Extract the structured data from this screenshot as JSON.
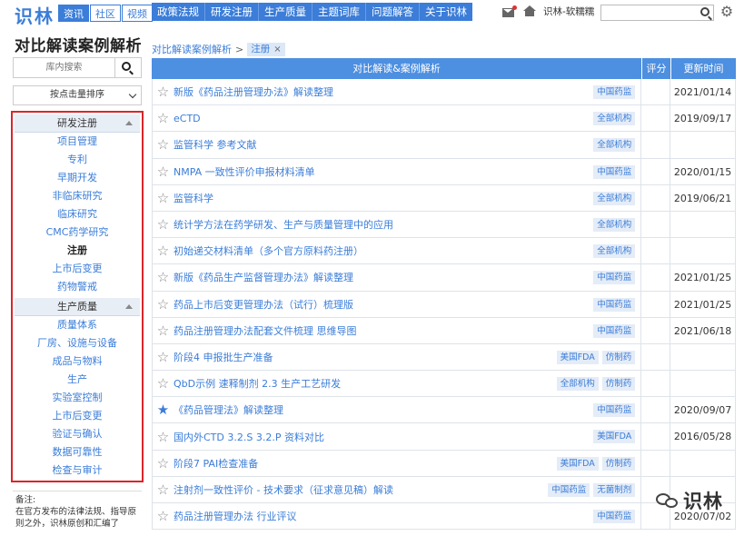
{
  "header": {
    "logo": "识林",
    "site_tabs": [
      {
        "label": "资讯",
        "active": true
      },
      {
        "label": "社区",
        "active": false
      },
      {
        "label": "视频",
        "active": false
      }
    ],
    "nav": [
      "政策法规",
      "研发注册",
      "生产质量",
      "主题词库",
      "问题解答",
      "关于识林"
    ],
    "user_name": "识林-软糯糯",
    "search_value": ""
  },
  "sidebar": {
    "title": "对比解读案例解析",
    "search_placeholder": "库内搜索",
    "sort_label": "按点击量排序",
    "groups": [
      {
        "header": "研发注册",
        "items": [
          {
            "label": "项目管理",
            "active": false
          },
          {
            "label": "专利",
            "active": false
          },
          {
            "label": "早期开发",
            "active": false
          },
          {
            "label": "非临床研究",
            "active": false
          },
          {
            "label": "临床研究",
            "active": false
          },
          {
            "label": "CMC药学研究",
            "active": false
          },
          {
            "label": "注册",
            "active": true
          },
          {
            "label": "上市后变更",
            "active": false
          },
          {
            "label": "药物警戒",
            "active": false
          }
        ]
      },
      {
        "header": "生产质量",
        "items": [
          {
            "label": "质量体系",
            "active": false
          },
          {
            "label": "厂房、设施与设备",
            "active": false
          },
          {
            "label": "成品与物料",
            "active": false
          },
          {
            "label": "生产",
            "active": false
          },
          {
            "label": "实验室控制",
            "active": false
          },
          {
            "label": "上市后变更",
            "active": false
          },
          {
            "label": "验证与确认",
            "active": false
          },
          {
            "label": "数据可靠性",
            "active": false
          },
          {
            "label": "检查与审计",
            "active": false
          }
        ]
      }
    ],
    "note_title": "备注:",
    "note_text": "在官方发布的法律法规、指导原则之外，识林原创和汇编了"
  },
  "breadcrumb": {
    "root": "对比解读案例解析",
    "separator": ">",
    "tag": "注册",
    "close": "×"
  },
  "table": {
    "headers": {
      "title": "对比解读&案例解析",
      "score": "评分",
      "date": "更新时间"
    },
    "rows": [
      {
        "title": "新版《药品注册管理办法》解读整理",
        "tags": [
          "中国药监"
        ],
        "date": "2021/01/14",
        "starred": false
      },
      {
        "title": "eCTD",
        "tags": [
          "全部机构"
        ],
        "date": "2019/09/17",
        "starred": false
      },
      {
        "title": "监管科学 参考文献",
        "tags": [
          "全部机构"
        ],
        "date": "",
        "starred": false
      },
      {
        "title": "NMPA 一致性评价申报材料清单",
        "tags": [
          "中国药监"
        ],
        "date": "2020/01/15",
        "starred": false
      },
      {
        "title": "监管科学",
        "tags": [
          "全部机构"
        ],
        "date": "2019/06/21",
        "starred": false
      },
      {
        "title": "统计学方法在药学研发、生产与质量管理中的应用",
        "tags": [
          "全部机构"
        ],
        "date": "",
        "starred": false
      },
      {
        "title": "初始递交材料清单（多个官方原料药注册）",
        "tags": [
          "全部机构"
        ],
        "date": "",
        "starred": false
      },
      {
        "title": "新版《药品生产监督管理办法》解读整理",
        "tags": [
          "中国药监"
        ],
        "date": "2021/01/25",
        "starred": false
      },
      {
        "title": "药品上市后变更管理办法（试行）梳理版",
        "tags": [
          "中国药监"
        ],
        "date": "2021/01/25",
        "starred": false
      },
      {
        "title": "药品注册管理办法配套文件梳理 思维导图",
        "tags": [
          "中国药监"
        ],
        "date": "2021/06/18",
        "starred": false
      },
      {
        "title": "阶段4 申报批生产准备",
        "tags": [
          "美国FDA",
          "仿制药"
        ],
        "date": "",
        "starred": false
      },
      {
        "title": "QbD示例 速释制剂 2.3 生产工艺研发",
        "tags": [
          "全部机构",
          "仿制药"
        ],
        "date": "",
        "starred": false
      },
      {
        "title": "《药品管理法》解读整理",
        "tags": [
          "中国药监"
        ],
        "date": "2020/09/07",
        "starred": true
      },
      {
        "title": "国内外CTD 3.2.S 3.2.P 资料对比",
        "tags": [
          "美国FDA"
        ],
        "date": "2016/05/28",
        "starred": false
      },
      {
        "title": "阶段7 PAI检查准备",
        "tags": [
          "美国FDA",
          "仿制药"
        ],
        "date": "",
        "starred": false
      },
      {
        "title": "注射剂一致性评价 - 技术要求（征求意见稿）解读",
        "tags": [
          "中国药监",
          "无菌制剂"
        ],
        "date": "",
        "starred": false
      },
      {
        "title": "药品注册管理办法 行业评议",
        "tags": [
          "中国药监"
        ],
        "date": "2020/07/02",
        "starred": false
      }
    ]
  },
  "watermark": "识林"
}
